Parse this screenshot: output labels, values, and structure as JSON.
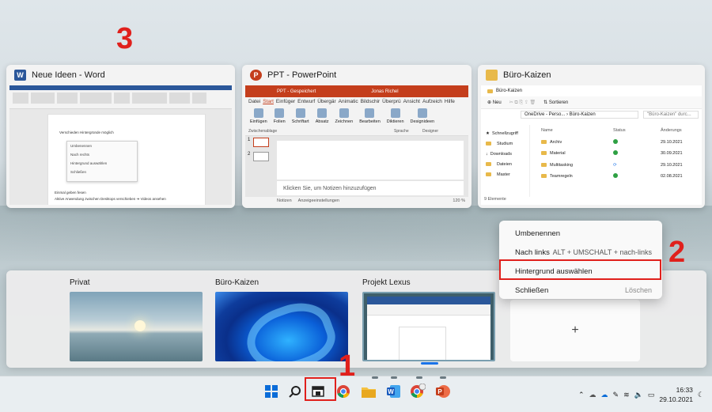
{
  "annotations": {
    "step1": "1",
    "step2": "2",
    "step3": "3"
  },
  "windows": [
    {
      "title": "Neue Ideen - Word",
      "icon": "word-icon",
      "color": "#2b579a"
    },
    {
      "title": "PPT - PowerPoint",
      "icon": "powerpoint-icon",
      "color": "#c43e1c"
    },
    {
      "title": "Büro-Kaizen",
      "icon": "folder-icon",
      "color": "#e8b94a"
    }
  ],
  "word": {
    "lines": [
      "Verschieden Hintergründe möglich",
      "Einmal geben fesen",
      "Aktive Anwendung zwischen Desktops verschieben ➔ Videos ansehen"
    ],
    "menu": [
      "Umbenennen",
      "Nach rechts",
      "Hintergrund auswählen",
      "Schließen"
    ]
  },
  "powerpoint": {
    "titlebar": "PPT - Gespeichert",
    "user": "Jonas Richel",
    "menu": [
      "Datei",
      "Start",
      "Einfüger",
      "Entwurf",
      "Übergär",
      "Animatic",
      "Bildschir",
      "Überprü",
      "Ansicht",
      "Aufzeich",
      "Hilfe"
    ],
    "groups": [
      "Einfügen",
      "Folien",
      "Schriftart",
      "Absatz",
      "Zeichnen",
      "Bearbeiten",
      "Diktieren",
      "Designideen"
    ],
    "group_labels": [
      "Zwischenablage",
      "Sprache",
      "Designer"
    ],
    "slides": [
      "1",
      "2"
    ],
    "notes_placeholder": "Klicken Sie, um Notizen hinzuzufügen",
    "status": [
      "Notizen",
      "Anzeigeeinstellungen",
      "120 %"
    ]
  },
  "explorer": {
    "tab": "Büro-Kaizen",
    "toolbar": [
      "Neu",
      "Sortieren"
    ],
    "path": "OneDrive - Perso... › Büro-Kaizen",
    "search_placeholder": "\"Büro-Kaizen\" durc...",
    "nav": [
      "Schnellzugriff",
      "Studium",
      "Downloads",
      "Dateien",
      "Master"
    ],
    "columns": [
      "Name",
      "Status",
      "Änderungs"
    ],
    "rows": [
      {
        "name": "Archiv",
        "date": "29.10.2021"
      },
      {
        "name": "Material",
        "date": "30.09.2021"
      },
      {
        "name": "Multitasking",
        "date": "29.10.2021"
      },
      {
        "name": "Teamregeln",
        "date": "02.08.2021"
      }
    ],
    "status": "9 Elemente"
  },
  "desktops": [
    {
      "label": "Privat"
    },
    {
      "label": "Büro-Kaizen"
    },
    {
      "label": "Projekt Lexus"
    }
  ],
  "new_desktop": "+",
  "context_menu": [
    {
      "label": "Umbenennen",
      "shortcut": ""
    },
    {
      "label": "Nach links",
      "shortcut": "ALT + UMSCHALT + nach-links"
    },
    {
      "label": "Hintergrund auswählen",
      "shortcut": ""
    },
    {
      "label": "Schließen",
      "shortcut": "Löschen"
    }
  ],
  "taskbar": {
    "apps": [
      "windows-start-icon",
      "search-icon",
      "task-view-icon",
      "chrome-icon",
      "file-explorer-icon",
      "word-icon",
      "chrome-profile-icon",
      "powerpoint-icon"
    ],
    "time": "16:33",
    "date": "29.10.2021"
  }
}
